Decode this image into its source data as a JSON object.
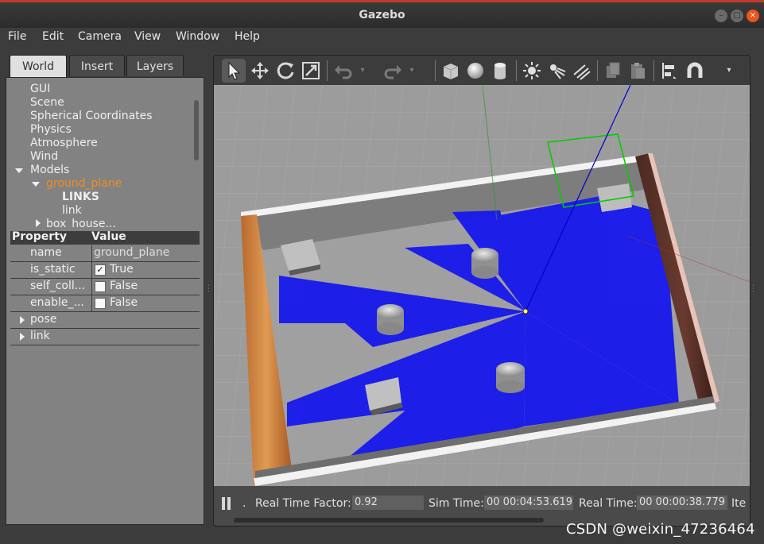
{
  "window": {
    "title": "Gazebo",
    "minimize": "–",
    "maximize": "□",
    "close": "×"
  },
  "menu": [
    "File",
    "Edit",
    "Camera",
    "View",
    "Window",
    "Help"
  ],
  "tabs": [
    "World",
    "Insert",
    "Layers"
  ],
  "tree": {
    "items": [
      "GUI",
      "Scene",
      "Spherical Coordinates",
      "Physics",
      "Atmosphere",
      "Wind"
    ],
    "models": "Models",
    "ground_plane": "ground_plane",
    "links_header": "LINKS",
    "link": "link",
    "box_house": "box_house..."
  },
  "properties": {
    "header_property": "Property",
    "header_value": "Value",
    "rows": [
      {
        "key": "name",
        "value": "ground_plane"
      },
      {
        "key": "is_static",
        "value": "True",
        "checked": true
      },
      {
        "key": "self_coll...",
        "value": "False",
        "checked": false
      },
      {
        "key": "enable_...",
        "value": "False",
        "checked": false
      }
    ],
    "groups": [
      "pose",
      "link"
    ]
  },
  "toolbar_icons": [
    "select-arrow-icon",
    "translate-icon",
    "rotate-icon",
    "scale-icon",
    "undo-icon",
    "redo-icon",
    "box-shape-icon",
    "sphere-shape-icon",
    "cylinder-shape-icon",
    "point-light-icon",
    "spot-light-icon",
    "directional-light-icon",
    "copy-icon",
    "paste-icon",
    "align-icon",
    "magnet-icon"
  ],
  "status": {
    "real_time_factor_label": "Real Time Factor:",
    "real_time_factor": "0.92",
    "sim_time_label": "Sim Time:",
    "sim_time": "00 00:04:53.619",
    "real_time_label": "Real Time:",
    "real_time": "00 00:00:38.779",
    "iterations_label": "Ite",
    "dot": "."
  },
  "watermark": "CSDN @weixin_47236464",
  "colors": {
    "laser": "#0000ff",
    "selection": "#00cc00",
    "wall_white": "#f2f2f2",
    "accent": "#e95420"
  }
}
